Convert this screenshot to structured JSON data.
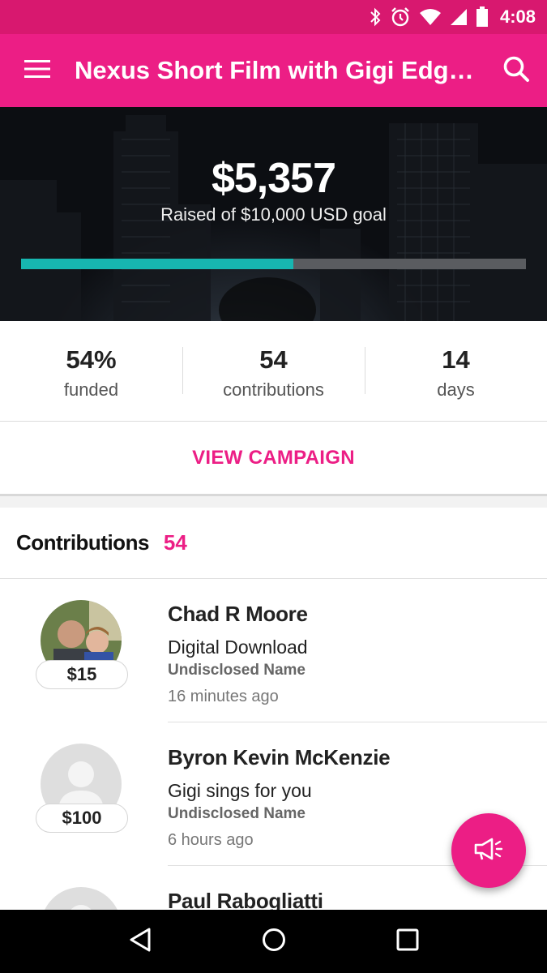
{
  "status_bar": {
    "time": "4:08",
    "icons": [
      "bluetooth-icon",
      "alarm-icon",
      "wifi-icon",
      "signal-icon",
      "battery-icon"
    ]
  },
  "app_bar": {
    "title": "Nexus Short Film with Gigi Edgl…",
    "menu_icon": "hamburger-menu-icon",
    "search_icon": "search-icon"
  },
  "hero": {
    "amount": "$5,357",
    "subtitle": "Raised of $10,000 USD goal",
    "progress_fraction": 0.54
  },
  "stats": [
    {
      "value": "54%",
      "label": "funded"
    },
    {
      "value": "54",
      "label": "contributions"
    },
    {
      "value": "14",
      "label": "days"
    }
  ],
  "view_campaign": {
    "label": "VIEW CAMPAIGN"
  },
  "contributions": {
    "title": "Contributions",
    "count": "54",
    "items": [
      {
        "name": "Chad R Moore",
        "reward": "Digital Download",
        "privacy": "Undisclosed Name",
        "time": "16 minutes ago",
        "amount": "$15",
        "avatar": "photo"
      },
      {
        "name": "Byron Kevin McKenzie",
        "reward": "Gigi sings for you",
        "privacy": "Undisclosed Name",
        "time": "6 hours ago",
        "amount": "$100",
        "avatar": "placeholder"
      },
      {
        "name": "Paul Rabogliatti",
        "reward": "",
        "privacy": "",
        "time": "",
        "amount": "",
        "avatar": "placeholder"
      }
    ]
  },
  "fab": {
    "icon": "megaphone-icon"
  },
  "nav_bar": {
    "icons": [
      "back-icon",
      "home-icon",
      "recents-icon"
    ]
  },
  "colors": {
    "brand": "#ec1e85",
    "status_bar": "#d8186f",
    "progress": "#17b6b0"
  }
}
